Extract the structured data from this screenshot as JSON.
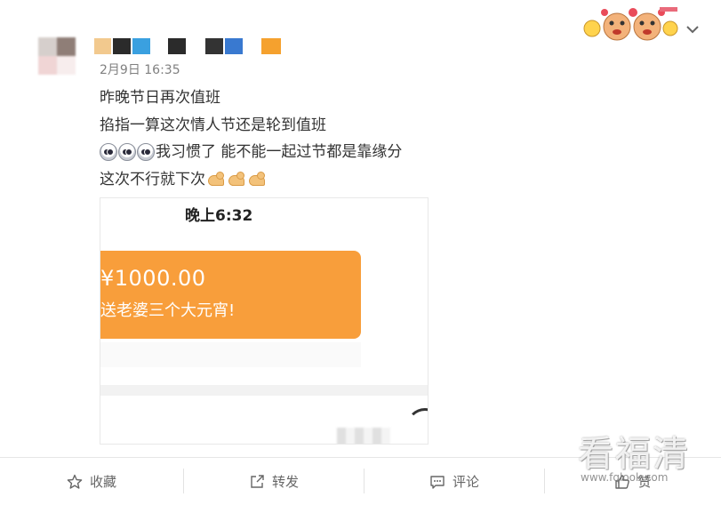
{
  "post": {
    "timestamp": "2月9日 16:35",
    "lines": [
      "昨晚节日再次值班",
      "掐指一算这次情人节还是轮到值班",
      "我习惯了 能不能一起过节都是靠缘分",
      "这次不行就下次"
    ],
    "emoji_icons": [
      "scared-face-icon",
      "scared-face-icon",
      "scared-face-icon"
    ],
    "trailing_icons": [
      "muscle-icon",
      "muscle-icon",
      "muscle-icon"
    ]
  },
  "image": {
    "time": "晚上6:32",
    "amount": "¥1000.00",
    "message": "送老婆三个大元宵!"
  },
  "actions": [
    {
      "icon": "star-icon",
      "label": "收藏"
    },
    {
      "icon": "share-icon",
      "label": "转发"
    },
    {
      "icon": "comment-icon",
      "label": "评论"
    },
    {
      "icon": "like-icon",
      "label": "赞"
    }
  ],
  "watermark": {
    "text": "看福清",
    "sub": "www.fqlook.com"
  },
  "colors": {
    "accent_orange": "#f89e3b",
    "text": "#333333",
    "muted": "#808080"
  }
}
